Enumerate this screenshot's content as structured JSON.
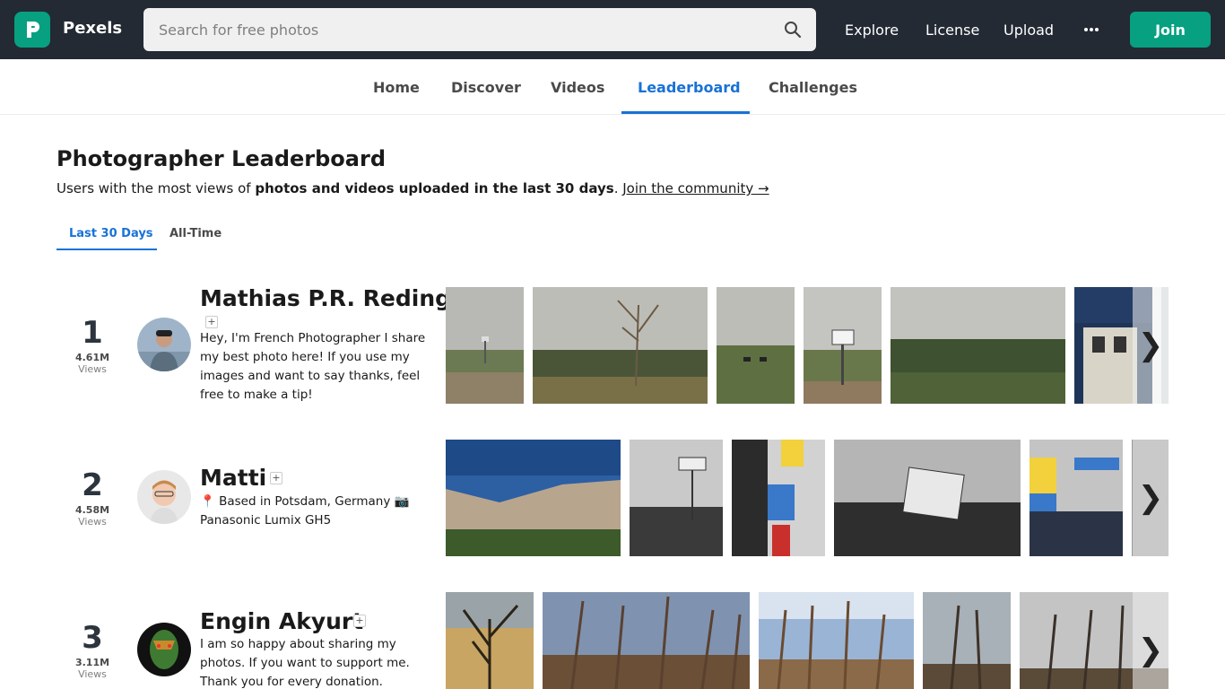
{
  "header": {
    "brand": "Pexels",
    "search_placeholder": "Search for free photos",
    "nav": [
      "Explore",
      "License",
      "Upload"
    ],
    "join_label": "Join",
    "accent_color": "#07a081"
  },
  "subnav": {
    "tabs": [
      "Home",
      "Discover",
      "Videos",
      "Leaderboard",
      "Challenges"
    ],
    "active": "Leaderboard",
    "active_color": "#1872d6"
  },
  "main": {
    "title": "Photographer Leaderboard",
    "subtitle_prefix": "Users with the most views of ",
    "subtitle_bold": "photos and videos uploaded in the last 30 days",
    "subtitle_link": "Join the community →",
    "period_tabs": [
      "Last 30 Days",
      "All-Time"
    ],
    "active_period": "Last 30 Days"
  },
  "leaderboard": [
    {
      "rank": "1",
      "views": "4.61M",
      "views_label": "Views",
      "name": "Mathias P.R. Reding",
      "bio": "Hey, I'm French Photographer I share my best photo here! If you use my images and want to say thanks, feel free to make a tip!"
    },
    {
      "rank": "2",
      "views": "4.58M",
      "views_label": "Views",
      "name": "Matti",
      "bio": "📍 Based in Potsdam, Germany 📷 Panasonic Lumix GH5"
    },
    {
      "rank": "3",
      "views": "3.11M",
      "views_label": "Views",
      "name": "Engin Akyurt",
      "bio": "I am so happy about sharing my photos. If you want to support me. Thank you for every donation."
    }
  ],
  "icons": {
    "search": "search-icon",
    "more": "more-horizontal-icon",
    "next": "chevron-right-icon",
    "follow": "plus-icon"
  }
}
